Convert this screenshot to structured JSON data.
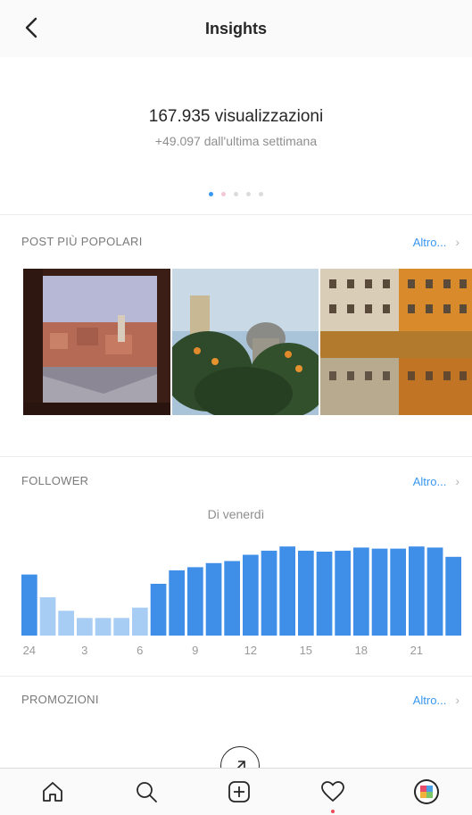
{
  "header": {
    "title": "Insights",
    "back_icon": "chevron-left-icon"
  },
  "summary": {
    "views": "167.935 visualizzazioni",
    "delta": "+49.097 dall'ultima settimana",
    "page_dots": 5,
    "active_dot": 0
  },
  "posts_section": {
    "title": "POST PIÙ POPOLARI",
    "more": "Altro...",
    "posts": [
      {
        "subject": "window view of rooftops"
      },
      {
        "subject": "orange tree and domes"
      },
      {
        "subject": "colorful buildings reflected in river"
      }
    ]
  },
  "followers_section": {
    "title": "FOLLOWER",
    "more": "Altro...",
    "caption": "Di venerdì"
  },
  "promotions_section": {
    "title": "PROMOZIONI",
    "more": "Altro...",
    "button_icon": "arrow-up-right-icon"
  },
  "tabbar": {
    "items": [
      "home-icon",
      "search-icon",
      "add-icon",
      "heart-icon",
      "profile-avatar"
    ],
    "notification_on": "heart-icon"
  },
  "colors": {
    "accent": "#3897f0",
    "bar_dark": "#3f8ee8",
    "bar_light": "#a8cdf5"
  },
  "chart_data": {
    "type": "bar",
    "title": "Di venerdì",
    "categories": [
      "24",
      "1",
      "2",
      "3",
      "4",
      "5",
      "6",
      "7",
      "8",
      "9",
      "10",
      "11",
      "12",
      "13",
      "14",
      "15",
      "16",
      "17",
      "18",
      "19",
      "20",
      "21",
      "22",
      "23"
    ],
    "tick_labels": [
      "24",
      "3",
      "6",
      "9",
      "12",
      "15",
      "18",
      "21"
    ],
    "values": [
      59,
      37,
      24,
      17,
      17,
      17,
      27,
      50,
      63,
      66,
      70,
      72,
      78,
      82,
      86,
      82,
      81,
      82,
      85,
      84,
      84,
      86,
      85,
      76
    ],
    "ylim": [
      0,
      100
    ],
    "grid": false,
    "legend": "none"
  }
}
